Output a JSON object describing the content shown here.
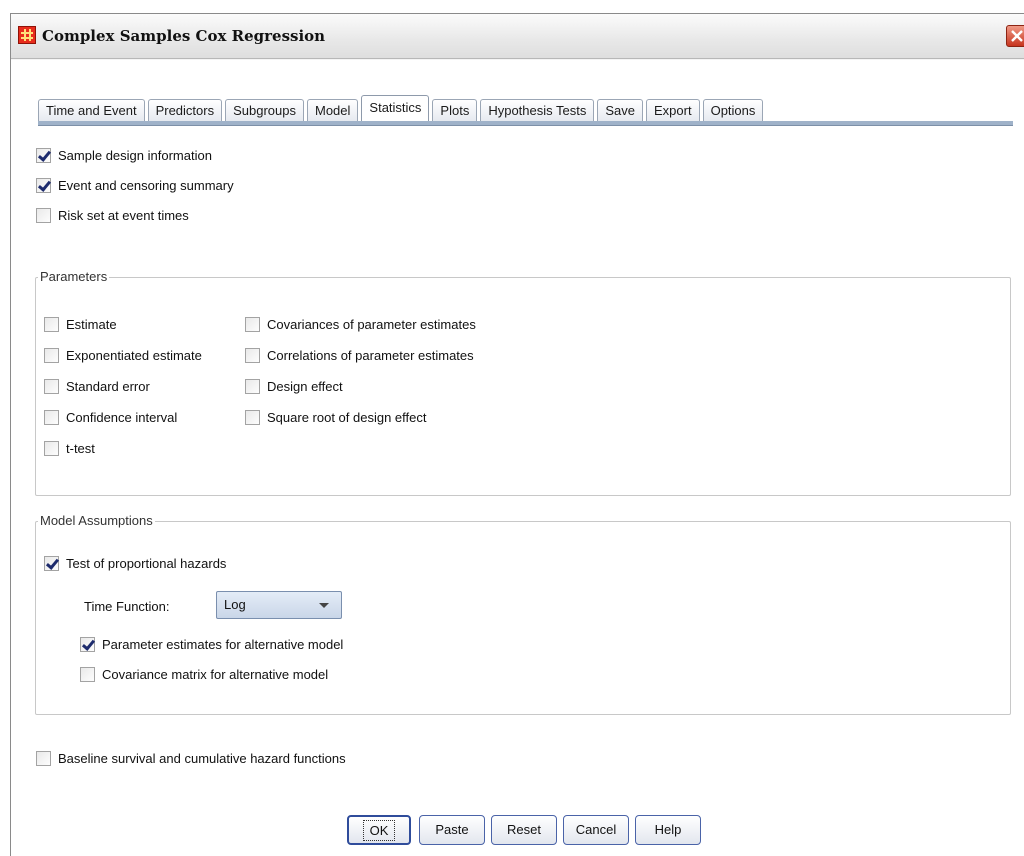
{
  "window": {
    "title": "Complex Samples Cox Regression"
  },
  "tabs": [
    {
      "label": "Time and Event",
      "active": false
    },
    {
      "label": "Predictors",
      "active": false
    },
    {
      "label": "Subgroups",
      "active": false
    },
    {
      "label": "Model",
      "active": false
    },
    {
      "label": "Statistics",
      "active": true
    },
    {
      "label": "Plots",
      "active": false
    },
    {
      "label": "Hypothesis Tests",
      "active": false
    },
    {
      "label": "Save",
      "active": false
    },
    {
      "label": "Export",
      "active": false
    },
    {
      "label": "Options",
      "active": false
    }
  ],
  "top_options": [
    {
      "label": "Sample design information",
      "checked": true
    },
    {
      "label": "Event and censoring summary",
      "checked": true
    },
    {
      "label": "Risk set at event times",
      "checked": false
    }
  ],
  "parameters": {
    "title": "Parameters",
    "col1": [
      {
        "label": "Estimate",
        "checked": false
      },
      {
        "label": "Exponentiated estimate",
        "checked": false
      },
      {
        "label": "Standard error",
        "checked": false
      },
      {
        "label": "Confidence interval",
        "checked": false
      },
      {
        "label": "t-test",
        "checked": false
      }
    ],
    "col2": [
      {
        "label": "Covariances of parameter estimates",
        "checked": false
      },
      {
        "label": "Correlations of parameter estimates",
        "checked": false
      },
      {
        "label": "Design effect",
        "checked": false
      },
      {
        "label": "Square root of design effect",
        "checked": false
      }
    ]
  },
  "assumptions": {
    "title": "Model Assumptions",
    "test_ph": {
      "label": "Test of proportional hazards",
      "checked": true
    },
    "time_function_label": "Time Function:",
    "time_function_value": "Log",
    "param_alt": {
      "label": "Parameter estimates for alternative model",
      "checked": true
    },
    "cov_alt": {
      "label": "Covariance matrix for alternative model",
      "checked": false
    }
  },
  "baseline": {
    "label": "Baseline survival and cumulative hazard functions",
    "checked": false
  },
  "buttons": {
    "ok": "OK",
    "paste": "Paste",
    "reset": "Reset",
    "cancel": "Cancel",
    "help": "Help"
  }
}
